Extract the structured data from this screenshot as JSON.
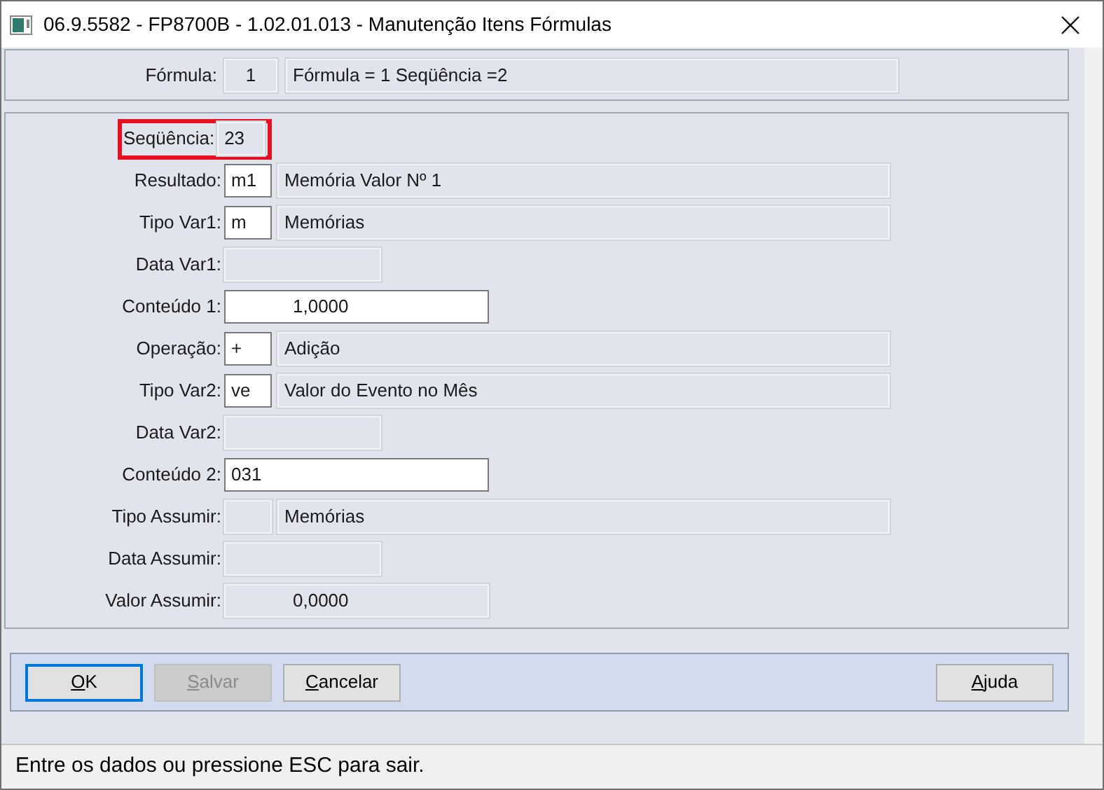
{
  "window": {
    "title": "06.9.5582 - FP8700B - 1.02.01.013 - Manutenção Itens Fórmulas"
  },
  "header": {
    "label": "Fórmula:",
    "fields": [
      {
        "kind": "code",
        "value": "1",
        "editable": false
      },
      {
        "kind": "description",
        "value": "Fórmula = 1 Seqüência =2",
        "editable": false
      }
    ]
  },
  "rows": [
    {
      "label": "Seqüência:",
      "highlighted": true,
      "fields": [
        {
          "kind": "plain",
          "value": "23",
          "editable": false
        }
      ]
    },
    {
      "label": "Resultado:",
      "highlighted": false,
      "fields": [
        {
          "kind": "code",
          "value": "m1",
          "editable": true
        },
        {
          "kind": "description",
          "value": "Memória Valor Nº 1",
          "editable": false
        }
      ]
    },
    {
      "label": "Tipo Var1:",
      "highlighted": false,
      "fields": [
        {
          "kind": "code",
          "value": "m",
          "editable": true
        },
        {
          "kind": "description",
          "value": "Memórias",
          "editable": false
        }
      ]
    },
    {
      "label": "Data Var1:",
      "highlighted": false,
      "fields": [
        {
          "kind": "date",
          "editable": false
        }
      ]
    },
    {
      "label": "Conteúdo 1:",
      "highlighted": false,
      "fields": [
        {
          "kind": "numeric",
          "value": "1,0000",
          "editable": true
        }
      ]
    },
    {
      "label": "Operação:",
      "highlighted": false,
      "fields": [
        {
          "kind": "code",
          "value": "+",
          "editable": true
        },
        {
          "kind": "description",
          "value": "Adição",
          "editable": false
        }
      ]
    },
    {
      "label": "Tipo Var2:",
      "highlighted": false,
      "fields": [
        {
          "kind": "code",
          "value": "ve",
          "editable": true
        },
        {
          "kind": "description",
          "value": "Valor do Evento no Mês",
          "editable": false
        }
      ]
    },
    {
      "label": "Data Var2:",
      "highlighted": false,
      "fields": [
        {
          "kind": "date",
          "editable": false
        }
      ]
    },
    {
      "label": "Conteúdo 2:",
      "highlighted": false,
      "fields": [
        {
          "kind": "text",
          "value": "031",
          "editable": true
        }
      ]
    },
    {
      "label": "Tipo Assumir:",
      "highlighted": false,
      "fields": [
        {
          "kind": "code",
          "editable": false
        },
        {
          "kind": "description",
          "value": "Memórias",
          "editable": false
        }
      ]
    },
    {
      "label": "Data Assumir:",
      "highlighted": false,
      "fields": [
        {
          "kind": "date",
          "editable": false
        }
      ]
    },
    {
      "label": "Valor Assumir:",
      "highlighted": false,
      "fields": [
        {
          "kind": "numeric",
          "value": "0,0000",
          "editable": false
        }
      ]
    }
  ],
  "buttons_left": [
    {
      "label": "OK",
      "focused": true,
      "disabled": false
    },
    {
      "label": "Salvar",
      "focused": false,
      "disabled": true
    },
    {
      "label": "Cancelar",
      "focused": false,
      "disabled": false
    }
  ],
  "buttons_right": [
    {
      "label": "Ajuda",
      "focused": false,
      "disabled": false
    }
  ],
  "status_bar": "Entre os dados ou pressione ESC para sair."
}
